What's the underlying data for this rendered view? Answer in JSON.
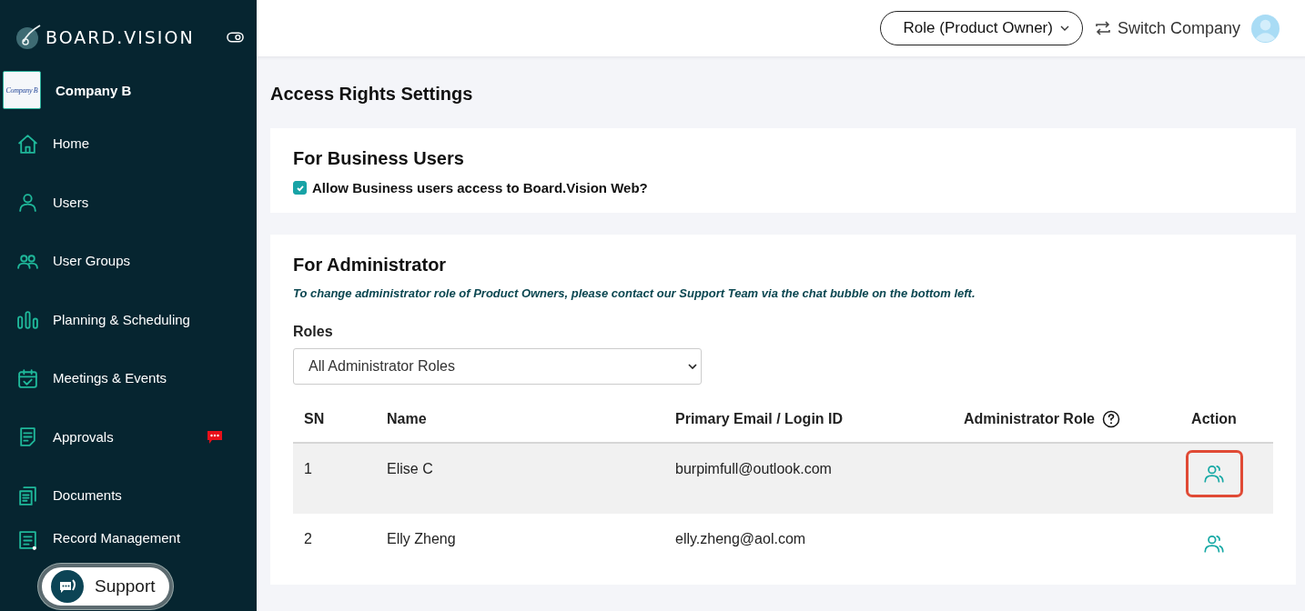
{
  "sidebar": {
    "brand": "BOARD.VISION",
    "company": {
      "logo_text": "Company B",
      "name": "Company B"
    },
    "items": [
      {
        "kind": "home",
        "label": "Home",
        "badge": false
      },
      {
        "kind": "user",
        "label": "Users",
        "badge": false
      },
      {
        "kind": "users",
        "label": "User Groups",
        "badge": false
      },
      {
        "kind": "bars",
        "label": "Planning & Scheduling",
        "badge": false
      },
      {
        "kind": "calendar",
        "label": "Meetings & Events",
        "badge": false
      },
      {
        "kind": "doc",
        "label": "Approvals",
        "badge": true
      },
      {
        "kind": "docs",
        "label": "Documents",
        "badge": false
      },
      {
        "kind": "record",
        "label": "Record Management",
        "badge": false
      }
    ],
    "support": {
      "label": "Support"
    }
  },
  "header": {
    "role": "Role (Product Owner)",
    "switch": "Switch Company"
  },
  "page": {
    "title": "Access Rights Settings",
    "business": {
      "heading": "For Business Users",
      "checkbox": {
        "label": "Allow Business users access to Board.Vision Web?",
        "checked": true
      }
    },
    "admin": {
      "heading": "For Administrator",
      "note": "To change administrator role of Product Owners, please contact our Support Team via the chat bubble on the bottom left.",
      "roles_label": "Roles",
      "roles_value": "All Administrator Roles",
      "columns": [
        "SN",
        "Name",
        "Primary Email / Login ID",
        "Administrator Role",
        "Action"
      ],
      "rows": [
        {
          "sn": "1",
          "name": "Elise C",
          "email": "burpimfull@outlook.com",
          "selected": true
        },
        {
          "sn": "2",
          "name": "Elly Zheng",
          "email": "elly.zheng@aol.com",
          "selected": false
        }
      ]
    }
  }
}
